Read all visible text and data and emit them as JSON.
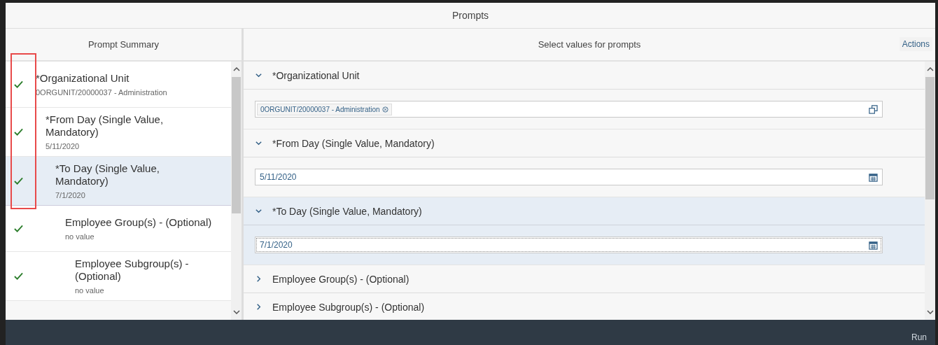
{
  "window": {
    "title": "Prompts"
  },
  "summary": {
    "title": "Prompt Summary",
    "items": [
      {
        "label": "*Organizational Unit",
        "value": "0ORGUNIT/20000037 - Administration",
        "checked": true,
        "selected": false
      },
      {
        "label": "*From Day (Single Value, Mandatory)",
        "value": "5/11/2020",
        "checked": true,
        "selected": false
      },
      {
        "label": "*To Day (Single Value, Mandatory)",
        "value": "7/1/2020",
        "checked": true,
        "selected": true
      },
      {
        "label": "Employee Group(s) - (Optional)",
        "value": "no value",
        "checked": true,
        "selected": false
      },
      {
        "label": "Employee Subgroup(s) - (Optional)",
        "value": "no value",
        "checked": true,
        "selected": false
      }
    ]
  },
  "values": {
    "title": "Select values for prompts",
    "actions": "Actions",
    "sections": [
      {
        "label": "*Organizational Unit",
        "expanded": true,
        "selected": false,
        "field": {
          "kind": "tokens",
          "tokens": [
            "0ORGUNIT/20000037 - Administration"
          ]
        }
      },
      {
        "label": "*From Day (Single Value, Mandatory)",
        "expanded": true,
        "selected": false,
        "field": {
          "kind": "date",
          "value": "5/11/2020",
          "focused": false
        }
      },
      {
        "label": "*To Day (Single Value, Mandatory)",
        "expanded": true,
        "selected": true,
        "field": {
          "kind": "date",
          "value": "7/1/2020",
          "focused": true
        }
      },
      {
        "label": "Employee Group(s) - (Optional)",
        "expanded": false,
        "selected": false
      },
      {
        "label": "Employee Subgroup(s) - (Optional)",
        "expanded": false,
        "selected": false
      }
    ]
  },
  "footer": {
    "run": "Run"
  }
}
